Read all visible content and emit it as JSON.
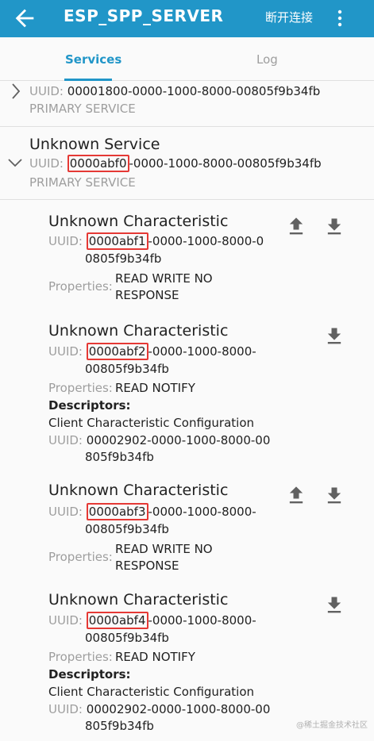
{
  "appbar": {
    "title": "ESP_SPP_SERVER",
    "disconnect_label": "断开连接"
  },
  "tabs": {
    "services": "Services",
    "log": "Log"
  },
  "services": [
    {
      "uuid_label": "UUID:",
      "uuid": "00001800-0000-1000-8000-00805f9b34fb",
      "type": "PRIMARY SERVICE"
    },
    {
      "name": "Unknown Service",
      "uuid_label": "UUID:",
      "uuid_highlight": "0000abf0",
      "uuid_rest": "-0000-1000-8000-00805f9b34fb",
      "type": "PRIMARY SERVICE"
    }
  ],
  "characteristics": [
    {
      "name": "Unknown Characteristic",
      "uuid_label": "UUID:",
      "uuid_highlight": "0000abf1",
      "uuid_rest_line1": "-0000-1000-8000-0",
      "uuid_rest_line2": "0805f9b34fb",
      "properties_label": "Properties:",
      "properties_line1": "READ WRITE NO",
      "properties_line2": "RESPONSE"
    },
    {
      "name": "Unknown Characteristic",
      "uuid_label": "UUID:",
      "uuid_highlight": "0000abf2",
      "uuid_rest_line1": "-0000-1000-8000-",
      "uuid_rest_line2": "00805f9b34fb",
      "properties_label": "Properties:",
      "properties_line1": "READ NOTIFY",
      "descriptors_label": "Descriptors:",
      "descriptor_name": "Client Characteristic Configuration",
      "descriptor_uuid_label": "UUID:",
      "descriptor_uuid_line1": "00002902-0000-1000-8000-00",
      "descriptor_uuid_line2": "805f9b34fb"
    },
    {
      "name": "Unknown Characteristic",
      "uuid_label": "UUID:",
      "uuid_highlight": "0000abf3",
      "uuid_rest_line1": "-0000-1000-8000-",
      "uuid_rest_line2": "00805f9b34fb",
      "properties_label": "Properties:",
      "properties_line1": "READ WRITE NO",
      "properties_line2": "RESPONSE"
    },
    {
      "name": "Unknown Characteristic",
      "uuid_label": "UUID:",
      "uuid_highlight": "0000abf4",
      "uuid_rest_line1": "-0000-1000-8000-",
      "uuid_rest_line2": "00805f9b34fb",
      "properties_label": "Properties:",
      "properties_line1": "READ NOTIFY",
      "descriptors_label": "Descriptors:",
      "descriptor_name": "Client Characteristic Configuration",
      "descriptor_uuid_label": "UUID:",
      "descriptor_uuid_line1": "00002902-0000-1000-8000-00",
      "descriptor_uuid_line2": "805f9b34fb"
    }
  ],
  "watermark": "@稀土掘金技术社区",
  "colors": {
    "appbar": "#2196c8",
    "highlight_box": "#e53935"
  }
}
